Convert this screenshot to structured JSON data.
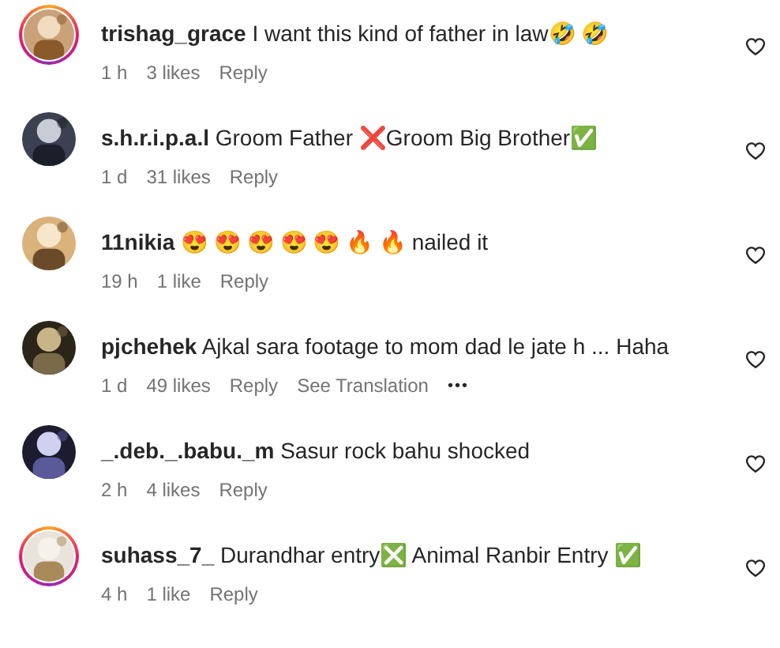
{
  "comments": [
    {
      "username": "trishag_grace",
      "text": "I want this kind of father in law🤣 🤣",
      "time": "1 h",
      "likes": "3 likes",
      "reply": "Reply",
      "story_ring": true
    },
    {
      "username": "s.h.r.i.p.a.l",
      "text": "Groom Father ❌Groom Big Brother✅",
      "time": "1 d",
      "likes": "31 likes",
      "reply": "Reply",
      "story_ring": false
    },
    {
      "username": "11nikia",
      "text": "😍 😍 😍 😍 😍 🔥 🔥 nailed it",
      "time": "19 h",
      "likes": "1 like",
      "reply": "Reply",
      "story_ring": false
    },
    {
      "username": "pjchehek",
      "text": "Ajkal sara footage to mom dad le jate h ... Haha",
      "time": "1 d",
      "likes": "49 likes",
      "reply": "Reply",
      "translation": "See Translation",
      "more": "•••",
      "story_ring": false
    },
    {
      "username": "_.deb._.babu._m",
      "text": "Sasur rock bahu shocked",
      "time": "2 h",
      "likes": "4 likes",
      "reply": "Reply",
      "story_ring": false
    },
    {
      "username": "suhass_7_",
      "text": "Durandhar entry❎  Animal Ranbir Entry ✅",
      "time": "4 h",
      "likes": "1 like",
      "reply": "Reply",
      "story_ring": true
    }
  ]
}
